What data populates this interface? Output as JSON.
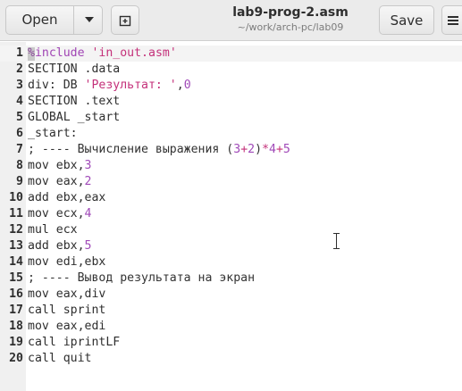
{
  "header": {
    "open_label": "Open",
    "save_label": "Save",
    "title": "lab9-prog-2.asm",
    "subtitle": "~/work/arch-pc/lab09"
  },
  "icons": {
    "dropdown": "chevron-down-icon",
    "new_tab": "new-tab-icon",
    "menu": "hamburger-menu-icon",
    "text_cursor": "ibeam-cursor-icon"
  },
  "colors": {
    "keyword_purple": "#a044b4",
    "string_pink": "#c4317a",
    "text": "#2e2e2e"
  },
  "editor": {
    "lines": [
      {
        "n": "1",
        "tokens": [
          {
            "t": "%include",
            "c": "pre"
          },
          {
            "t": " ",
            "c": "plain"
          },
          {
            "t": "'in_out.asm'",
            "c": "str"
          }
        ]
      },
      {
        "n": "2",
        "tokens": [
          {
            "t": "SECTION .data",
            "c": "plain"
          }
        ]
      },
      {
        "n": "3",
        "tokens": [
          {
            "t": "div: DB ",
            "c": "plain"
          },
          {
            "t": "'Результат: '",
            "c": "str"
          },
          {
            "t": ",",
            "c": "plain"
          },
          {
            "t": "0",
            "c": "num"
          }
        ]
      },
      {
        "n": "4",
        "tokens": [
          {
            "t": "SECTION .text",
            "c": "plain"
          }
        ]
      },
      {
        "n": "5",
        "tokens": [
          {
            "t": "GLOBAL _start",
            "c": "plain"
          }
        ]
      },
      {
        "n": "6",
        "tokens": [
          {
            "t": "_start:",
            "c": "plain"
          }
        ]
      },
      {
        "n": "7",
        "tokens": [
          {
            "t": "; ---- Вычисление выражения (",
            "c": "cmt"
          },
          {
            "t": "3",
            "c": "num"
          },
          {
            "t": "+",
            "c": "op"
          },
          {
            "t": "2",
            "c": "num"
          },
          {
            "t": ")",
            "c": "cmt"
          },
          {
            "t": "*",
            "c": "op"
          },
          {
            "t": "4",
            "c": "num"
          },
          {
            "t": "+",
            "c": "op"
          },
          {
            "t": "5",
            "c": "num"
          }
        ]
      },
      {
        "n": "8",
        "tokens": [
          {
            "t": "mov ebx,",
            "c": "plain"
          },
          {
            "t": "3",
            "c": "num"
          }
        ]
      },
      {
        "n": "9",
        "tokens": [
          {
            "t": "mov eax,",
            "c": "plain"
          },
          {
            "t": "2",
            "c": "num"
          }
        ]
      },
      {
        "n": "10",
        "tokens": [
          {
            "t": "add ebx,eax",
            "c": "plain"
          }
        ]
      },
      {
        "n": "11",
        "tokens": [
          {
            "t": "mov ecx,",
            "c": "plain"
          },
          {
            "t": "4",
            "c": "num"
          }
        ]
      },
      {
        "n": "12",
        "tokens": [
          {
            "t": "mul ecx",
            "c": "plain"
          }
        ]
      },
      {
        "n": "13",
        "tokens": [
          {
            "t": "add ebx,",
            "c": "plain"
          },
          {
            "t": "5",
            "c": "num"
          }
        ]
      },
      {
        "n": "14",
        "tokens": [
          {
            "t": "mov edi,ebx",
            "c": "plain"
          }
        ]
      },
      {
        "n": "15",
        "tokens": [
          {
            "t": "; ---- Вывод результата на экран",
            "c": "cmt"
          }
        ]
      },
      {
        "n": "16",
        "tokens": [
          {
            "t": "mov eax,div",
            "c": "plain"
          }
        ]
      },
      {
        "n": "17",
        "tokens": [
          {
            "t": "call sprint",
            "c": "plain"
          }
        ]
      },
      {
        "n": "18",
        "tokens": [
          {
            "t": "mov eax,edi",
            "c": "plain"
          }
        ]
      },
      {
        "n": "19",
        "tokens": [
          {
            "t": "call iprintLF",
            "c": "plain"
          }
        ]
      },
      {
        "n": "20",
        "tokens": [
          {
            "t": "call quit",
            "c": "plain"
          }
        ]
      }
    ]
  }
}
